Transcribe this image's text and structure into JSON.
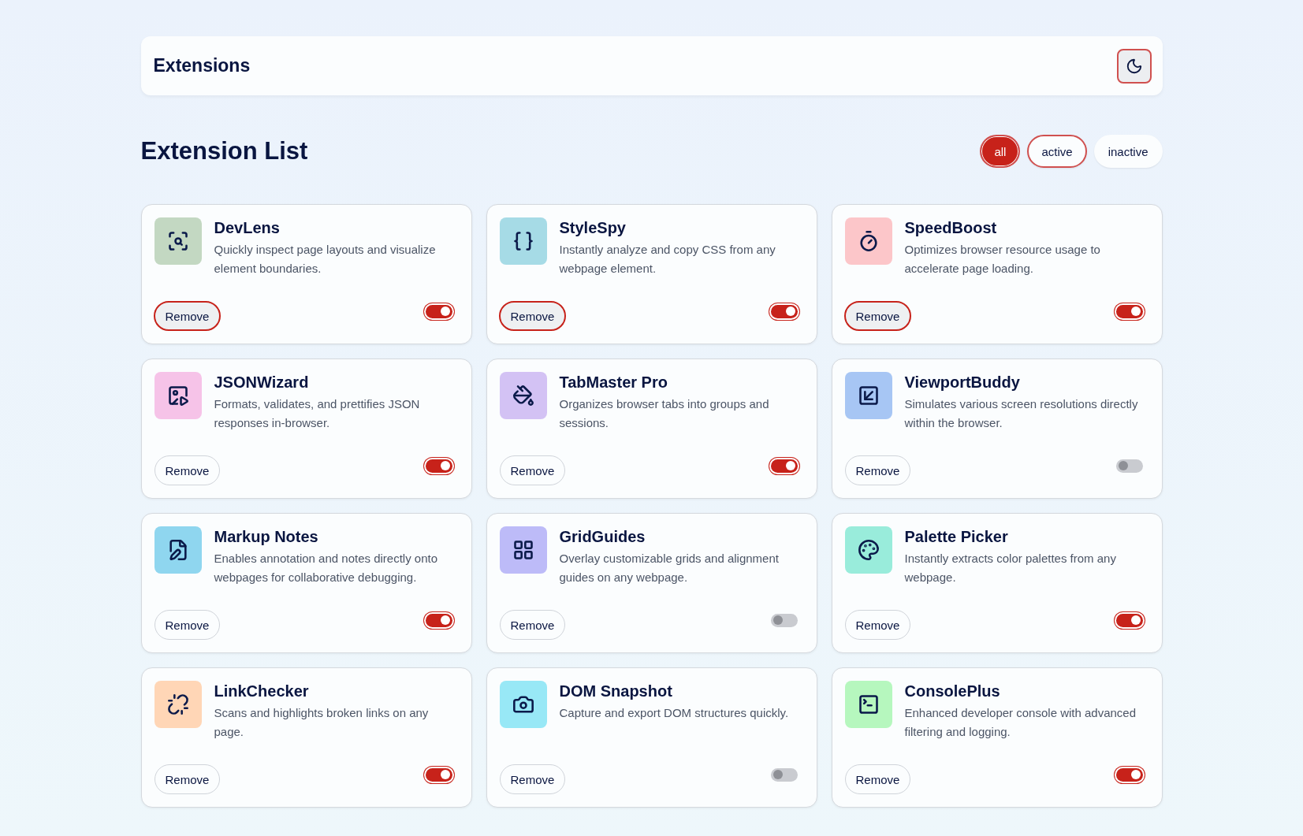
{
  "header": {
    "title": "Extensions"
  },
  "section": {
    "title": "Extension List"
  },
  "filters": [
    {
      "label": "all",
      "selected": true,
      "focused": true
    },
    {
      "label": "active",
      "selected": false,
      "focused": true
    },
    {
      "label": "inactive",
      "selected": false,
      "focused": false
    }
  ],
  "extensions": [
    {
      "name": "DevLens",
      "description": "Quickly inspect page layouts and visualize element boundaries.",
      "remove_label": "Remove",
      "remove_focused": true,
      "on": true
    },
    {
      "name": "StyleSpy",
      "description": "Instantly analyze and copy CSS from any webpage element.",
      "remove_label": "Remove",
      "remove_focused": true,
      "on": true
    },
    {
      "name": "SpeedBoost",
      "description": "Optimizes browser resource usage to accelerate page loading.",
      "remove_label": "Remove",
      "remove_focused": true,
      "on": true
    },
    {
      "name": "JSONWizard",
      "description": "Formats, validates, and prettifies JSON responses in-browser.",
      "remove_label": "Remove",
      "remove_focused": false,
      "on": true
    },
    {
      "name": "TabMaster Pro",
      "description": "Organizes browser tabs into groups and sessions.",
      "remove_label": "Remove",
      "remove_focused": false,
      "on": true
    },
    {
      "name": "ViewportBuddy",
      "description": "Simulates various screen resolutions directly within the browser.",
      "remove_label": "Remove",
      "remove_focused": false,
      "on": false
    },
    {
      "name": "Markup Notes",
      "description": "Enables annotation and notes directly onto webpages for collaborative debugging.",
      "remove_label": "Remove",
      "remove_focused": false,
      "on": true
    },
    {
      "name": "GridGuides",
      "description": "Overlay customizable grids and alignment guides on any webpage.",
      "remove_label": "Remove",
      "remove_focused": false,
      "on": false
    },
    {
      "name": "Palette Picker",
      "description": "Instantly extracts color palettes from any webpage.",
      "remove_label": "Remove",
      "remove_focused": false,
      "on": true
    },
    {
      "name": "LinkChecker",
      "description": "Scans and highlights broken links on any page.",
      "remove_label": "Remove",
      "remove_focused": false,
      "on": true
    },
    {
      "name": "DOM Snapshot",
      "description": "Capture and export DOM structures quickly.",
      "remove_label": "Remove",
      "remove_focused": false,
      "on": false
    },
    {
      "name": "ConsolePlus",
      "description": "Enhanced developer console with advanced filtering and logging.",
      "remove_label": "Remove",
      "remove_focused": false,
      "on": true
    }
  ]
}
